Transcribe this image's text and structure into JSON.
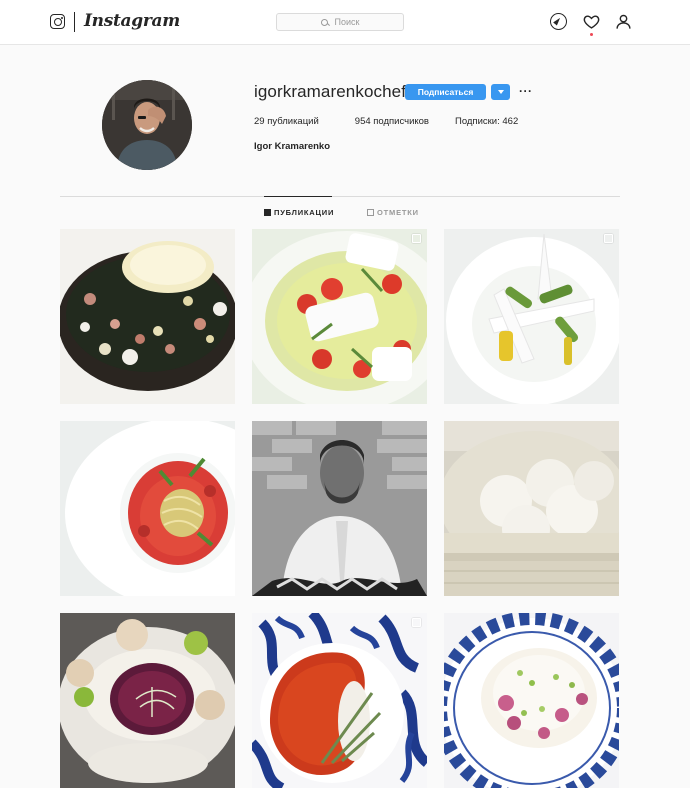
{
  "header": {
    "logo_text": "Instagram",
    "search_placeholder": "Поиск",
    "icons": [
      "instagram-icon",
      "search-icon",
      "compass-icon",
      "heart-icon",
      "user-icon"
    ]
  },
  "profile": {
    "username": "igorkramarenkochef",
    "follow_label": "Подписаться",
    "more_label": "···",
    "stats": {
      "posts": "29 публикаций",
      "followers": "954 подписчиков",
      "following": "Подписки: 462"
    },
    "full_name": "Igor Kramarenko"
  },
  "tabs": {
    "posts": "ПУБЛИКАЦИИ",
    "tagged": "ОТМЕТКИ"
  },
  "posts": [
    {
      "subject": "dish-herbs-cream",
      "multi": false
    },
    {
      "subject": "dish-strawberry-meringue",
      "multi": true
    },
    {
      "subject": "dish-asparagus-meringue",
      "multi": true
    },
    {
      "subject": "dish-pasta-tomato",
      "multi": false
    },
    {
      "subject": "chef-portrait",
      "multi": false
    },
    {
      "subject": "bao-buns-steamer",
      "multi": false
    },
    {
      "subject": "dish-risotto-scallops",
      "multi": false
    },
    {
      "subject": "dish-fish-blue-plate",
      "multi": true
    },
    {
      "subject": "dessert-pistachio",
      "multi": false
    }
  ],
  "colors": {
    "accent": "#3897f0",
    "notification": "#ed4956",
    "text": "#262626",
    "muted": "#999999"
  }
}
